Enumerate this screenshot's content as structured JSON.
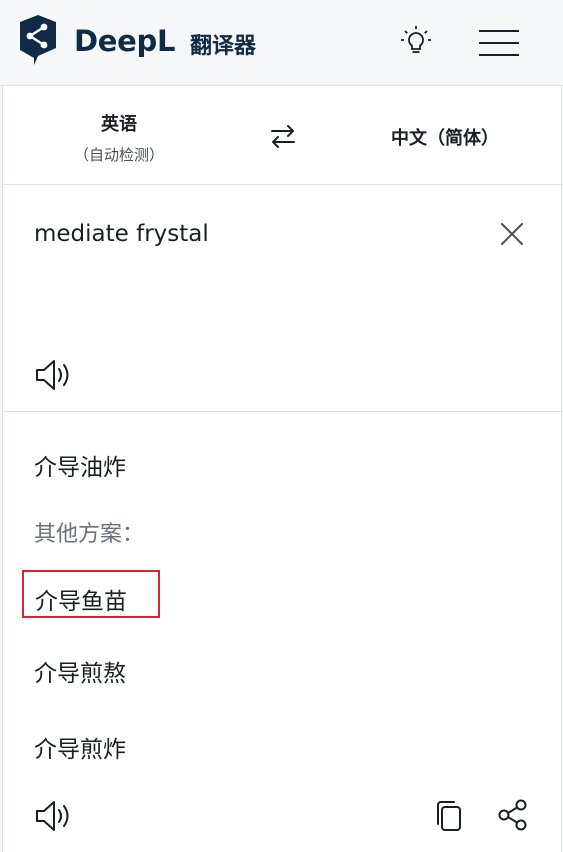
{
  "header": {
    "brand": "DeepL",
    "subtitle": "翻译器"
  },
  "languages": {
    "source_name": "英语",
    "source_detect": "（自动检测）",
    "target_name": "中文（简体）"
  },
  "source": {
    "text": "mediate frystal"
  },
  "translation": {
    "main": "介导油炸",
    "alternatives_label": "其他方案：",
    "alternatives": [
      "介导鱼苗",
      "介导煎熬",
      "介导煎炸"
    ]
  },
  "colors": {
    "brand": "#0f2b46",
    "highlight": "#d62430"
  },
  "icons": [
    "deepl-logo-icon",
    "lightbulb-icon",
    "menu-icon",
    "swap-icon",
    "close-icon",
    "speaker-icon",
    "copy-icon",
    "share-icon"
  ]
}
